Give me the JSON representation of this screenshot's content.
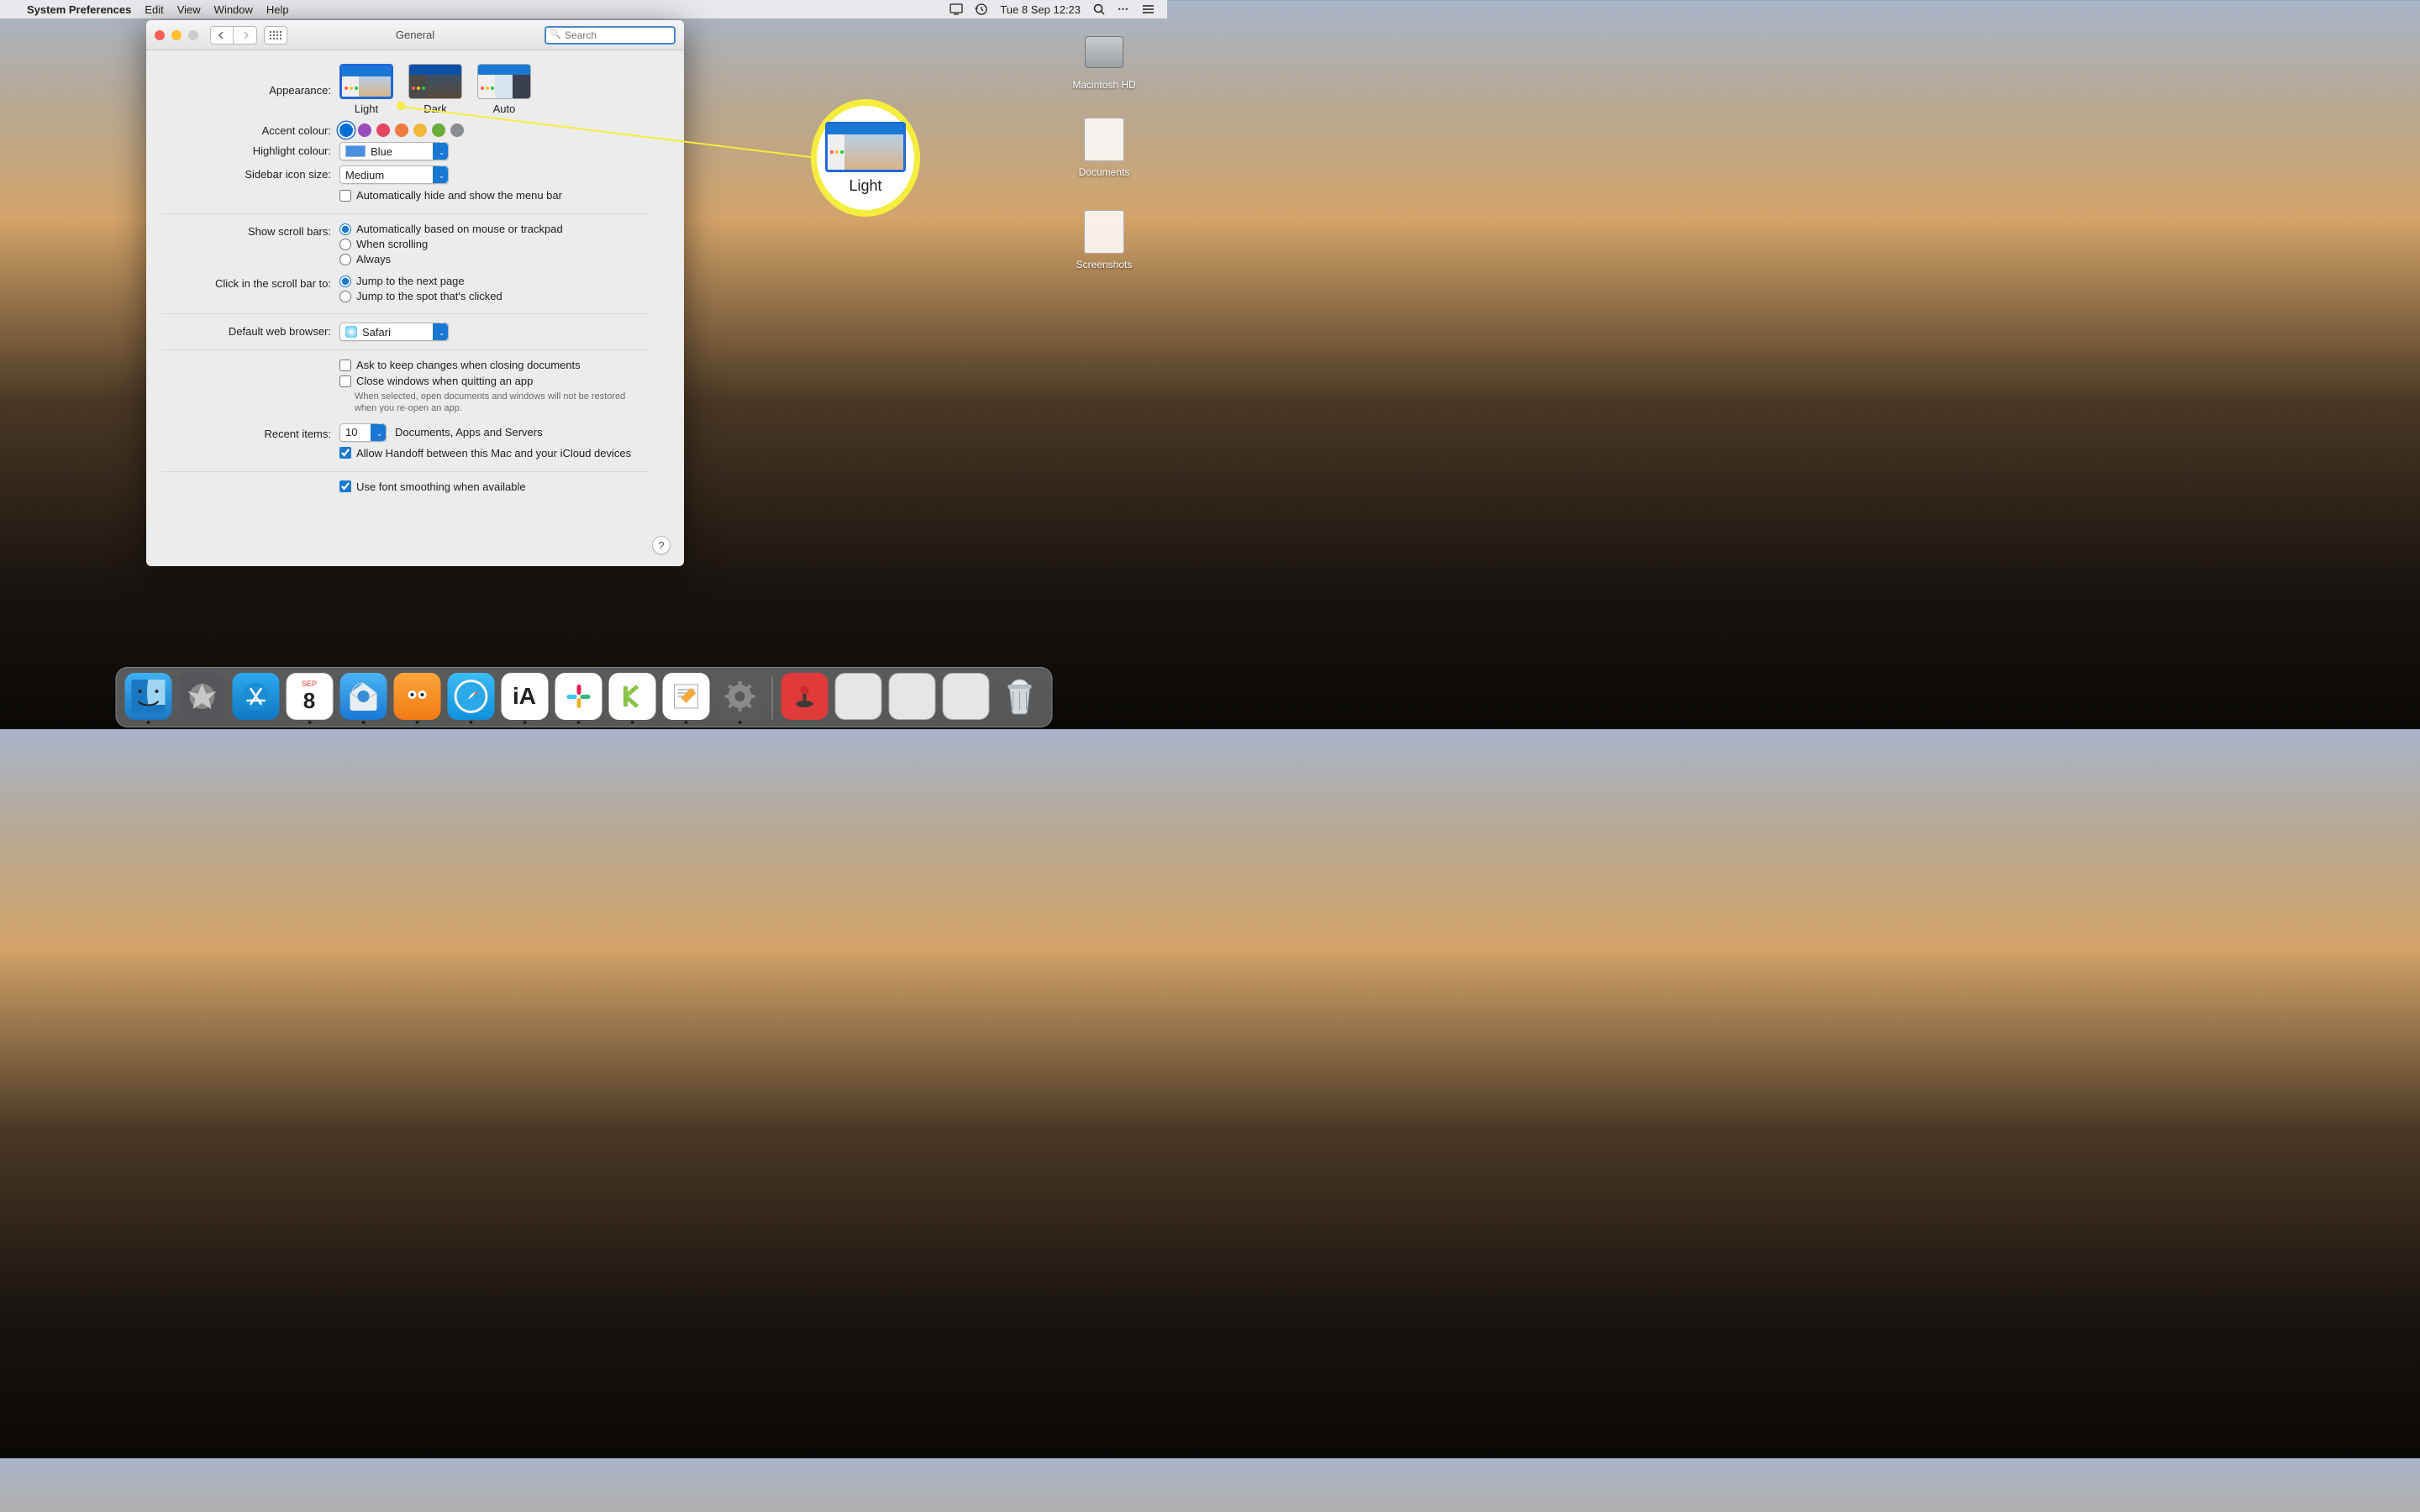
{
  "menubar": {
    "app": "System Preferences",
    "items": [
      "Edit",
      "View",
      "Window",
      "Help"
    ],
    "datetime": "Tue 8 Sep  12:23"
  },
  "desktop": {
    "hd": "Macintosh HD",
    "docs": "Documents",
    "ss": "Screenshots"
  },
  "window": {
    "title": "General",
    "search_placeholder": "Search"
  },
  "prefs": {
    "appearance_label": "Appearance:",
    "appearance": {
      "light": "Light",
      "dark": "Dark",
      "auto": "Auto",
      "selected": "Light"
    },
    "accent_label": "Accent colour:",
    "accent_colors": [
      "#0070d8",
      "#9a4bba",
      "#e5455f",
      "#ef7b3e",
      "#f3b838",
      "#6aab3a",
      "#8a8e93"
    ],
    "accent_selected_index": 0,
    "highlight_label": "Highlight colour:",
    "highlight_value": "Blue",
    "sidebar_label": "Sidebar icon size:",
    "sidebar_value": "Medium",
    "auto_hide_menu": "Automatically hide and show the menu bar",
    "scrollbars_label": "Show scroll bars:",
    "scrollbars": {
      "auto": "Automatically based on mouse or trackpad",
      "scrolling": "When scrolling",
      "always": "Always",
      "selected": "auto"
    },
    "click_label": "Click in the scroll bar to:",
    "click": {
      "next": "Jump to the next page",
      "spot": "Jump to the spot that's clicked",
      "selected": "next"
    },
    "browser_label": "Default web browser:",
    "browser_value": "Safari",
    "ask_save": "Ask to keep changes when closing documents",
    "close_quit": "Close windows when quitting an app",
    "close_quit_hint": "When selected, open documents and windows will not be restored when you re-open an app.",
    "recent_label": "Recent items:",
    "recent_value": "10",
    "recent_suffix": "Documents, Apps and Servers",
    "handoff": "Allow Handoff between this Mac and your iCloud devices",
    "font_smoothing": "Use font smoothing when available"
  },
  "callout": {
    "label": "Light"
  },
  "dock": {
    "cal_month": "SEP",
    "cal_day": "8"
  }
}
